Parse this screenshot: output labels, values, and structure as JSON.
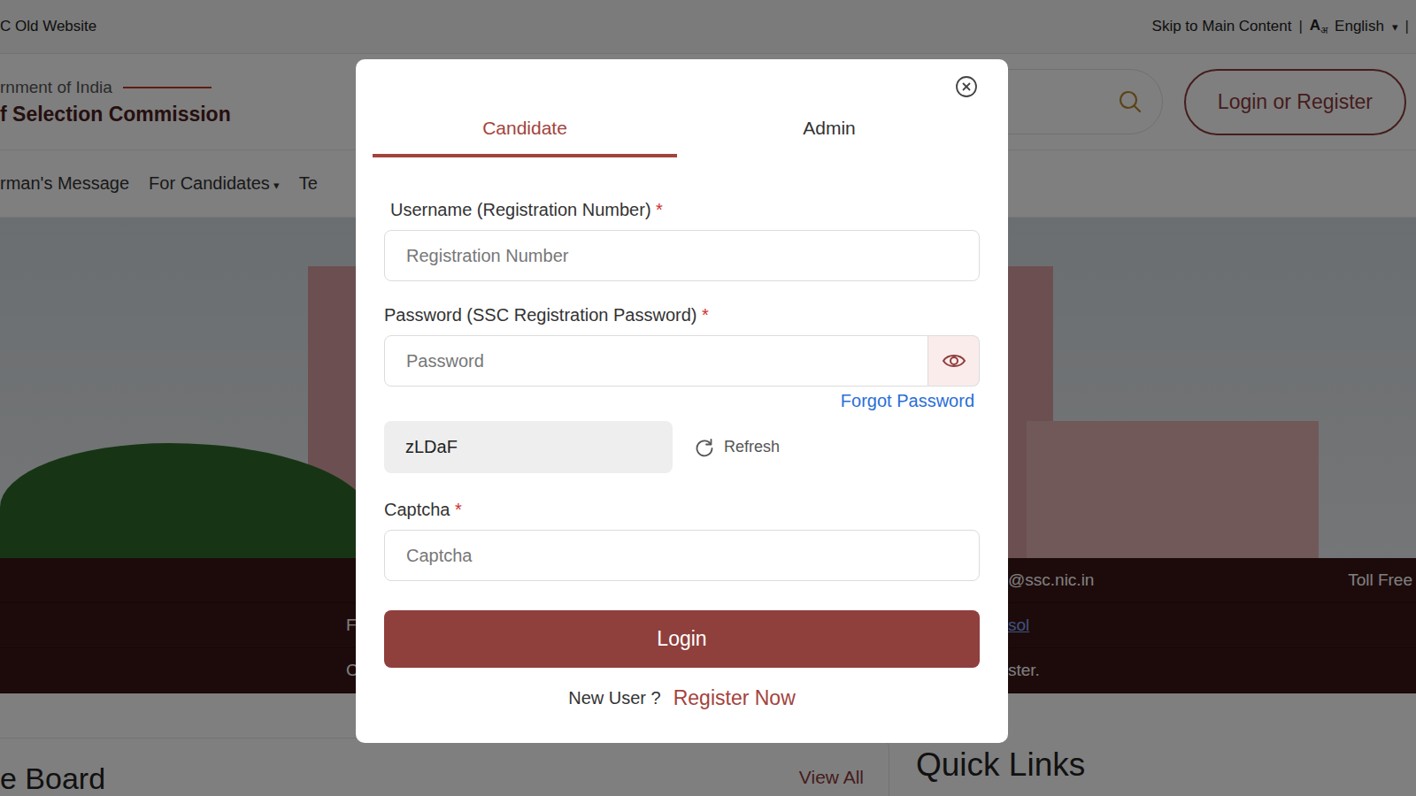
{
  "top_bar": {
    "left_link": "C Old Website",
    "skip": "Skip to Main Content",
    "separator": "|",
    "lang_letter": "A",
    "lang_sub": "अ",
    "language": "English",
    "caret": "▾",
    "end_separator": "|"
  },
  "header": {
    "org_line": "rnment of India",
    "org_name": "f Selection Commission",
    "login_button": "Login or Register"
  },
  "nav": [
    {
      "label": "rman's Message",
      "dropdown": false
    },
    {
      "label": "For Candidates",
      "dropdown": true
    },
    {
      "label": "Te",
      "dropdown": false
    }
  ],
  "nav_caret": "▾",
  "info_strip": [
    {
      "left": "",
      "right": "@ssc.nic.in",
      "far_right": "Toll Free",
      "link": false
    },
    {
      "left": "F",
      "right": "sol",
      "far_right": "",
      "link": true
    },
    {
      "left": "C",
      "right": "ster.",
      "far_right": "",
      "link": false
    }
  ],
  "notice_board": {
    "title": "e Board",
    "view_all": "View All"
  },
  "quick_links": {
    "title": "Quick Links"
  },
  "modal": {
    "tabs": [
      {
        "label": "Candidate",
        "selected": true
      },
      {
        "label": "Admin",
        "selected": false
      }
    ],
    "username": {
      "label": "Username (Registration Number)",
      "required_mark": "*",
      "placeholder": "Registration Number",
      "kind": "text"
    },
    "password": {
      "label": "Password (SSC Registration Password)",
      "required_mark": "*",
      "placeholder": "Password",
      "kind": "password"
    },
    "forgot": "Forgot Password",
    "captcha_code": "zLDaF",
    "refresh": "Refresh",
    "captcha": {
      "label": "Captcha",
      "required_mark": "*",
      "placeholder": "Captcha",
      "kind": "text"
    },
    "login": "Login",
    "register_prompt": "New User ?",
    "register_link": "Register Now"
  }
}
